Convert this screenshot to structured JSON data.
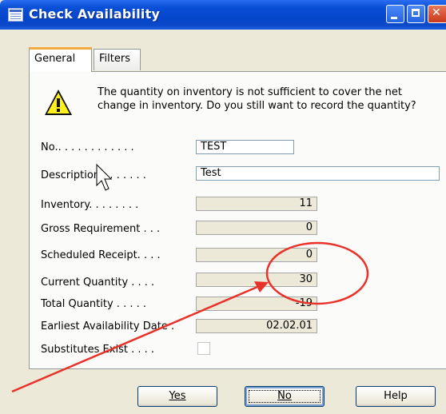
{
  "window": {
    "title": "Check Availability",
    "icon": "form-icon",
    "controls": [
      "minimize-icon",
      "maximize-icon",
      "close-icon"
    ],
    "title_color": "#0a4fd7"
  },
  "tabs": [
    {
      "label": "General",
      "selected": true
    },
    {
      "label": "Filters",
      "selected": false
    }
  ],
  "warning": {
    "icon": "warning-icon",
    "text": "The quantity on inventory is not sufficient to cover the net change in inventory. Do you still want to record the quantity?"
  },
  "fields": {
    "no": {
      "label": "No.. . . . . . . . . . . .",
      "value": "TEST"
    },
    "description": {
      "label": "Description . . . . . . .",
      "value": "Test"
    },
    "inventory": {
      "label": "Inventory. . . . . . . .",
      "value": "11"
    },
    "gross_requirement": {
      "label": "Gross Requirement . . .",
      "value": "0"
    },
    "scheduled_receipt": {
      "label": "Scheduled Receipt. . . .",
      "value": "0"
    },
    "current_quantity": {
      "label": "Current Quantity . . . .",
      "value": "30"
    },
    "total_quantity": {
      "label": "Total Quantity . . . . .",
      "value": "-19"
    },
    "earliest_availability_date": {
      "label": "Earliest Availability Date .",
      "value": "02.02.01"
    },
    "substitutes_exist": {
      "label": "Substitutes Exist . . . .",
      "checked": false
    }
  },
  "buttons": {
    "yes": "Yes",
    "no": "No",
    "help": "Help"
  },
  "annotation": {
    "color": "#e8322a",
    "highlights": "current-quantity-field"
  }
}
